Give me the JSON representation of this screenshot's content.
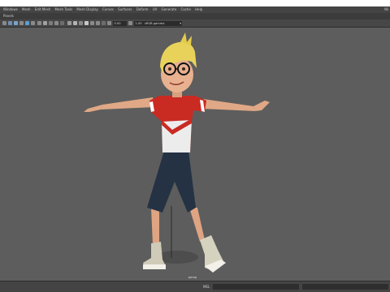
{
  "menubar": {
    "items": [
      "Windows",
      "Mesh",
      "Edit Mesh",
      "Mesh Tools",
      "Mesh Display",
      "Curves",
      "Surfaces",
      "Deform",
      "UV",
      "Generate",
      "Cache",
      "Help"
    ],
    "corner_label": "Wi"
  },
  "panel": {
    "label": "Panels"
  },
  "toolbar": {
    "field_a": "0.00",
    "field_b": "1.00",
    "colorspace": "sRGB gamma"
  },
  "viewport": {
    "camera_label": "persp"
  },
  "command_line": {
    "language": "MEL"
  },
  "colors": {
    "viewport_bg": "#5d5d5d",
    "menubar_bg": "#444444",
    "shirt_red": "#c92a22",
    "shorts": "#253244",
    "hair": "#e8d25a"
  }
}
